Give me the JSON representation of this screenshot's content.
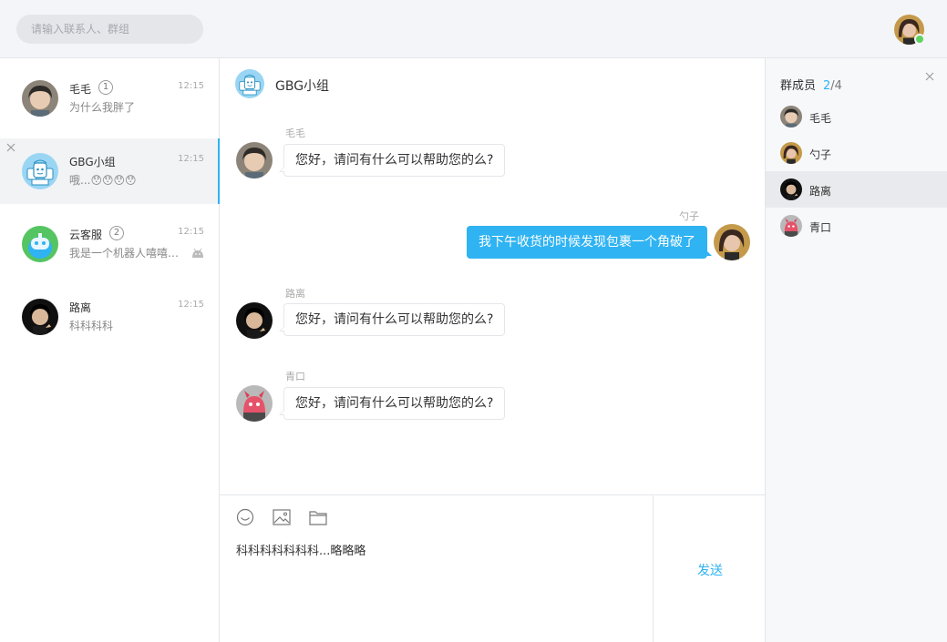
{
  "header": {
    "search_placeholder": "请输入联系人、群组",
    "status": "online"
  },
  "conversations": [
    {
      "name": "毛毛",
      "unread": "1",
      "time": "12:15",
      "preview": "为什么我胖了",
      "avatar": "boy-avatar"
    },
    {
      "name": "GBG小组",
      "time": "12:15",
      "preview": "哦...😯😯😯😯",
      "avatar": "group-robots-avatar",
      "active": true
    },
    {
      "name": "云客服",
      "unread": "2",
      "time": "12:15",
      "preview": "我是一个机器人嘻嘻…",
      "avatar": "robot-avatar",
      "tag_icon": "android-icon"
    },
    {
      "name": "路离",
      "time": "12:15",
      "preview": "科科科科",
      "avatar": "dark-avatar"
    }
  ],
  "chat": {
    "title": "GBG小组",
    "messages": [
      {
        "sender": "毛毛",
        "text": "您好，请问有什么可以帮助您的么?",
        "direction": "in"
      },
      {
        "sender": "勺子",
        "text": "我下午收货的时候发现包裹一个角破了",
        "direction": "out"
      },
      {
        "sender": "路离",
        "text": "您好，请问有什么可以帮助您的么?",
        "direction": "in"
      },
      {
        "sender": "青口",
        "text": "您好，请问有什么可以帮助您的么?",
        "direction": "in"
      }
    ]
  },
  "composer": {
    "tools": [
      "emoji-icon",
      "image-icon",
      "folder-icon"
    ],
    "draft": "科科科科科科科...略略略",
    "send_label": "发送"
  },
  "members_panel": {
    "title": "群成员",
    "online_count": "2",
    "total": "/4",
    "members": [
      {
        "name": "毛毛"
      },
      {
        "name": "勺子"
      },
      {
        "name": "路离",
        "active": true
      },
      {
        "name": "青口"
      }
    ]
  },
  "colors": {
    "accent": "#2fb3f2",
    "online": "#5fd35f",
    "header_bg": "#f4f5f8",
    "panel_bg": "#f7f8fa"
  }
}
